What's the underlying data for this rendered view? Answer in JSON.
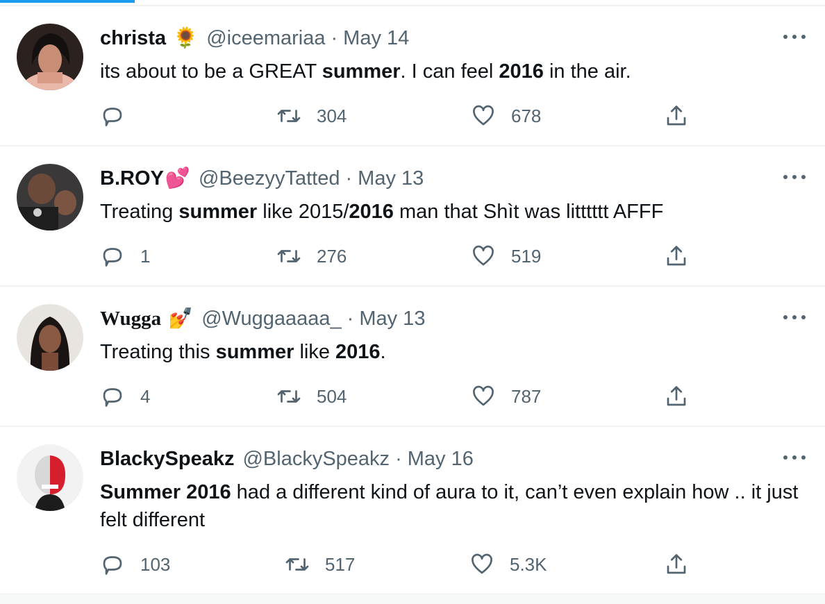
{
  "tweets": [
    {
      "name": "christa",
      "name_emoji": "🌻",
      "handle": "@iceemariaa",
      "dot": "·",
      "date": "May 14",
      "text_parts": [
        {
          "t": "its about to be a GREAT ",
          "b": false
        },
        {
          "t": "summer",
          "b": true
        },
        {
          "t": ". I can feel ",
          "b": false
        },
        {
          "t": "2016",
          "b": true
        },
        {
          "t": " in the air.",
          "b": false
        }
      ],
      "replies": "",
      "retweets": "304",
      "likes": "678"
    },
    {
      "name": "B.ROY",
      "name_emoji": "💕",
      "handle": "@BeezyyTatted",
      "dot": "·",
      "date": "May 13",
      "text_parts": [
        {
          "t": "Treating ",
          "b": false
        },
        {
          "t": "summer",
          "b": true
        },
        {
          "t": " like 2015/",
          "b": false
        },
        {
          "t": "2016",
          "b": true
        },
        {
          "t": " man that Shìt was litttttt AFFF",
          "b": false
        }
      ],
      "replies": "1",
      "retweets": "276",
      "likes": "519"
    },
    {
      "name": "Wugga",
      "name_emoji": "💅",
      "handle": "@Wuggaaaaa_",
      "dot": "·",
      "date": "May 13",
      "text_parts": [
        {
          "t": "Treating this ",
          "b": false
        },
        {
          "t": "summer",
          "b": true
        },
        {
          "t": " like ",
          "b": false
        },
        {
          "t": "2016",
          "b": true
        },
        {
          "t": ".",
          "b": false
        }
      ],
      "replies": "4",
      "retweets": "504",
      "likes": "787"
    },
    {
      "name": "BlackySpeakz",
      "name_emoji": "",
      "handle": "@BlackySpeakz",
      "dot": "·",
      "date": "May 16",
      "text_parts": [
        {
          "t": "Summer 2016",
          "b": true
        },
        {
          "t": " had a different kind of aura to it, can’t even explain how .. it just felt different",
          "b": false
        }
      ],
      "replies": "103",
      "retweets": "517",
      "likes": "5.3K"
    }
  ],
  "icons": {
    "reply": "reply-icon",
    "retweet": "retweet-icon",
    "like": "heart-icon",
    "share": "share-icon",
    "more": "more-icon"
  },
  "colors": {
    "accent": "#1d9bf0",
    "secondary_text": "#536471",
    "primary_text": "#0f1419",
    "divider": "#eff3f4"
  }
}
